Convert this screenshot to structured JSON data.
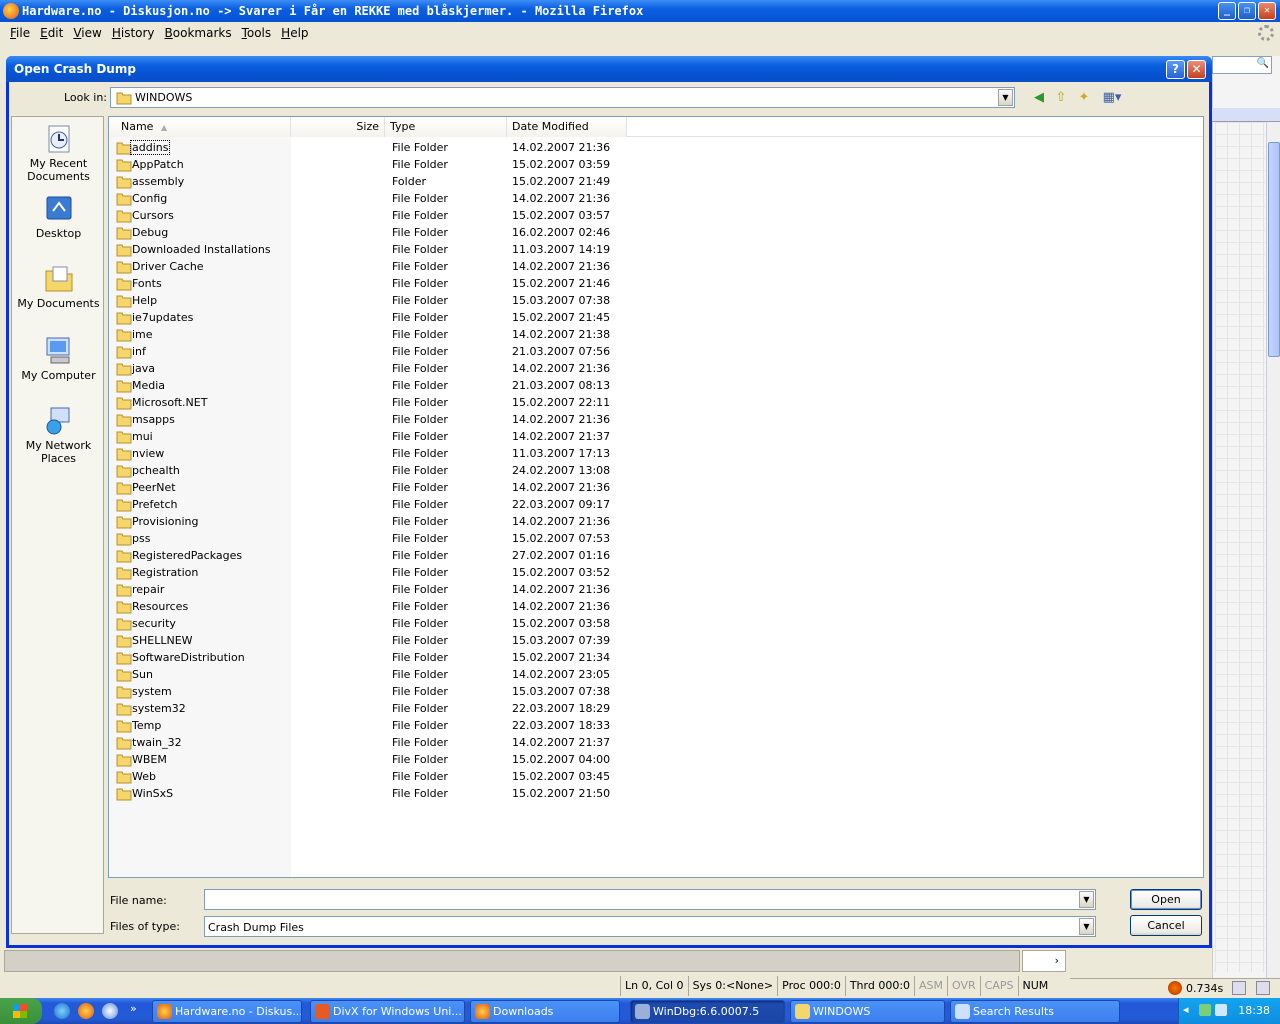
{
  "firefox": {
    "title": "Hardware.no - Diskusjon.no -> Svarer i Får en REKKE med blåskjermer. - Mozilla Firefox",
    "menu": [
      "File",
      "Edit",
      "View",
      "History",
      "Bookmarks",
      "Tools",
      "Help"
    ],
    "download_speed": "0.734s"
  },
  "dialog": {
    "title": "Open Crash Dump",
    "help_btn": "?",
    "close_btn": "✕",
    "look_in_label": "Look in:",
    "look_in_value": "WINDOWS",
    "places": [
      {
        "label": "My Recent Documents"
      },
      {
        "label": "Desktop"
      },
      {
        "label": "My Documents"
      },
      {
        "label": "My Computer"
      },
      {
        "label": "My Network Places"
      }
    ],
    "columns": {
      "name": "Name",
      "size": "Size",
      "type": "Type",
      "date": "Date Modified"
    },
    "files": [
      {
        "name": "addins",
        "type": "File Folder",
        "date": "14.02.2007 21:36"
      },
      {
        "name": "AppPatch",
        "type": "File Folder",
        "date": "15.02.2007 03:59"
      },
      {
        "name": "assembly",
        "type": "Folder",
        "date": "15.02.2007 21:49"
      },
      {
        "name": "Config",
        "type": "File Folder",
        "date": "14.02.2007 21:36"
      },
      {
        "name": "Cursors",
        "type": "File Folder",
        "date": "15.02.2007 03:57"
      },
      {
        "name": "Debug",
        "type": "File Folder",
        "date": "16.02.2007 02:46"
      },
      {
        "name": "Downloaded Installations",
        "type": "File Folder",
        "date": "11.03.2007 14:19"
      },
      {
        "name": "Driver Cache",
        "type": "File Folder",
        "date": "14.02.2007 21:36"
      },
      {
        "name": "Fonts",
        "type": "File Folder",
        "date": "15.02.2007 21:46"
      },
      {
        "name": "Help",
        "type": "File Folder",
        "date": "15.03.2007 07:38"
      },
      {
        "name": "ie7updates",
        "type": "File Folder",
        "date": "15.02.2007 21:45"
      },
      {
        "name": "ime",
        "type": "File Folder",
        "date": "14.02.2007 21:38"
      },
      {
        "name": "inf",
        "type": "File Folder",
        "date": "21.03.2007 07:56"
      },
      {
        "name": "java",
        "type": "File Folder",
        "date": "14.02.2007 21:36"
      },
      {
        "name": "Media",
        "type": "File Folder",
        "date": "21.03.2007 08:13"
      },
      {
        "name": "Microsoft.NET",
        "type": "File Folder",
        "date": "15.02.2007 22:11"
      },
      {
        "name": "msapps",
        "type": "File Folder",
        "date": "14.02.2007 21:36"
      },
      {
        "name": "mui",
        "type": "File Folder",
        "date": "14.02.2007 21:37"
      },
      {
        "name": "nview",
        "type": "File Folder",
        "date": "11.03.2007 17:13"
      },
      {
        "name": "pchealth",
        "type": "File Folder",
        "date": "24.02.2007 13:08"
      },
      {
        "name": "PeerNet",
        "type": "File Folder",
        "date": "14.02.2007 21:36"
      },
      {
        "name": "Prefetch",
        "type": "File Folder",
        "date": "22.03.2007 09:17"
      },
      {
        "name": "Provisioning",
        "type": "File Folder",
        "date": "14.02.2007 21:36"
      },
      {
        "name": "pss",
        "type": "File Folder",
        "date": "15.02.2007 07:53"
      },
      {
        "name": "RegisteredPackages",
        "type": "File Folder",
        "date": "27.02.2007 01:16"
      },
      {
        "name": "Registration",
        "type": "File Folder",
        "date": "15.02.2007 03:52"
      },
      {
        "name": "repair",
        "type": "File Folder",
        "date": "14.02.2007 21:36"
      },
      {
        "name": "Resources",
        "type": "File Folder",
        "date": "14.02.2007 21:36"
      },
      {
        "name": "security",
        "type": "File Folder",
        "date": "15.02.2007 03:58"
      },
      {
        "name": "SHELLNEW",
        "type": "File Folder",
        "date": "15.03.2007 07:39"
      },
      {
        "name": "SoftwareDistribution",
        "type": "File Folder",
        "date": "15.02.2007 21:34"
      },
      {
        "name": "Sun",
        "type": "File Folder",
        "date": "14.02.2007 23:05"
      },
      {
        "name": "system",
        "type": "File Folder",
        "date": "15.03.2007 07:38"
      },
      {
        "name": "system32",
        "type": "File Folder",
        "date": "22.03.2007 18:29"
      },
      {
        "name": "Temp",
        "type": "File Folder",
        "date": "22.03.2007 18:33"
      },
      {
        "name": "twain_32",
        "type": "File Folder",
        "date": "14.02.2007 21:37"
      },
      {
        "name": "WBEM",
        "type": "File Folder",
        "date": "15.02.2007 04:00"
      },
      {
        "name": "Web",
        "type": "File Folder",
        "date": "15.02.2007 03:45"
      },
      {
        "name": "WinSxS",
        "type": "File Folder",
        "date": "15.02.2007 21:50"
      }
    ],
    "file_name_label": "File name:",
    "file_name_value": "",
    "file_type_label": "Files of type:",
    "file_type_value": "Crash Dump Files",
    "open_btn": "Open",
    "cancel_btn": "Cancel"
  },
  "windbg_status": [
    "Ln 0, Col 0",
    "Sys 0:<None>",
    "Proc 000:0",
    "Thrd 000:0",
    "ASM",
    "OVR",
    "CAPS",
    "NUM"
  ],
  "taskbar": {
    "tasks": [
      {
        "label": "Hardware.no - Diskus...",
        "active": false
      },
      {
        "label": "DivX for Windows Uni...",
        "active": false
      },
      {
        "label": "Downloads",
        "active": false
      },
      {
        "label": "WinDbg:6.6.0007.5",
        "active": true
      },
      {
        "label": "WINDOWS",
        "active": false
      },
      {
        "label": "Search Results",
        "active": false
      }
    ],
    "clock": "18:38"
  },
  "colors": {
    "titlebar": "#0b5fe0",
    "folder": "#f5d66b",
    "accent": "#0831d9"
  }
}
